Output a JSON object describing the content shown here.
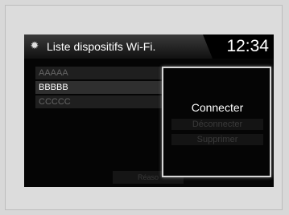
{
  "header": {
    "icon": "gear-icon",
    "title": "Liste dispositifs Wi-Fi.",
    "clock": "12:34"
  },
  "devices": [
    {
      "name": "AAAAA",
      "selected": false
    },
    {
      "name": "BBBBB",
      "selected": true
    },
    {
      "name": "CCCCC",
      "selected": false
    }
  ],
  "popup": {
    "connect": "Connecter",
    "disconnect": "Déconnecter",
    "delete": "Supprimer"
  },
  "bottom": {
    "button_label": "Réaso"
  }
}
